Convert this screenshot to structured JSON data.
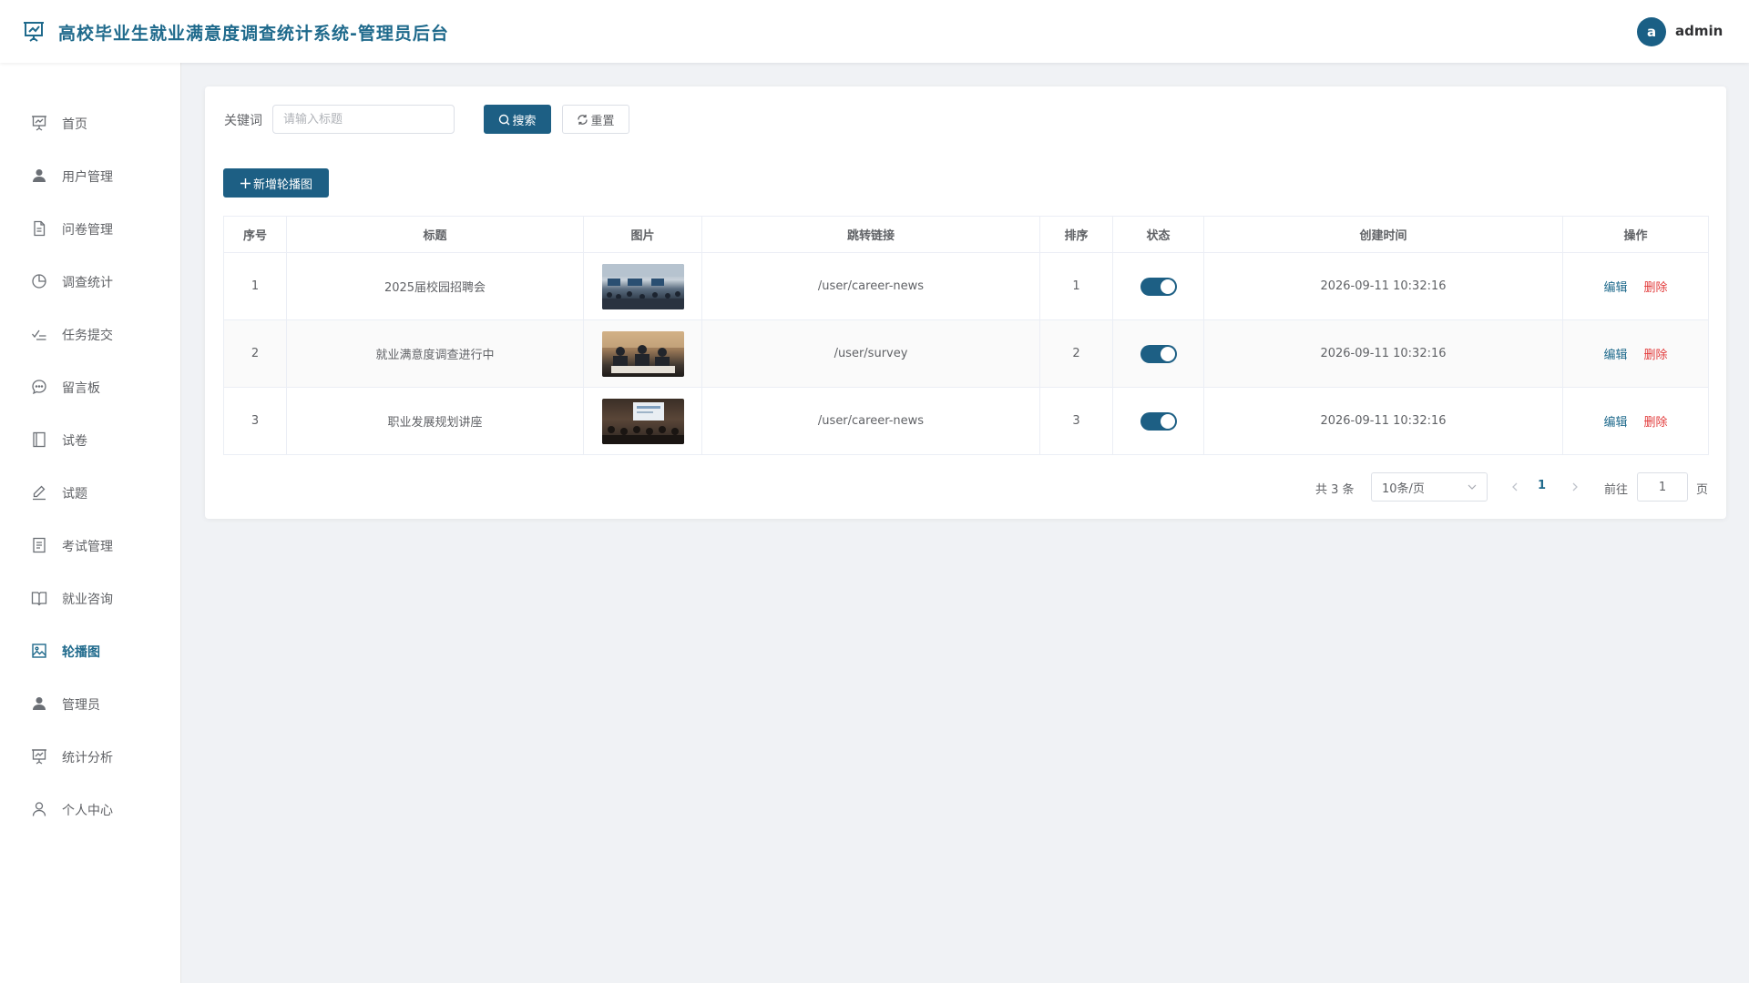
{
  "header": {
    "title": "高校毕业生就业满意度调查统计系统-管理员后台",
    "avatar_letter": "a",
    "username": "admin"
  },
  "sidebar": {
    "items": [
      {
        "label": "首页",
        "icon": "presentation-icon"
      },
      {
        "label": "用户管理",
        "icon": "user-icon"
      },
      {
        "label": "问卷管理",
        "icon": "document-icon"
      },
      {
        "label": "调查统计",
        "icon": "pie-chart-icon"
      },
      {
        "label": "任务提交",
        "icon": "task-check-icon"
      },
      {
        "label": "留言板",
        "icon": "chat-bubble-icon"
      },
      {
        "label": "试卷",
        "icon": "notebook-icon"
      },
      {
        "label": "试题",
        "icon": "edit-pen-icon"
      },
      {
        "label": "考试管理",
        "icon": "list-document-icon"
      },
      {
        "label": "就业咨询",
        "icon": "open-book-icon"
      },
      {
        "label": "轮播图",
        "icon": "image-icon"
      },
      {
        "label": "管理员",
        "icon": "user-icon"
      },
      {
        "label": "统计分析",
        "icon": "presentation-icon"
      },
      {
        "label": "个人中心",
        "icon": "user-outline-icon"
      }
    ],
    "active": "轮播图"
  },
  "search": {
    "label": "关键词",
    "placeholder": "请输入标题",
    "value": "",
    "search_button": "搜索",
    "reset_button": "重置"
  },
  "add_button": "新增轮播图",
  "table": {
    "headers": [
      "序号",
      "标题",
      "图片",
      "跳转链接",
      "排序",
      "状态",
      "创建时间",
      "操作"
    ],
    "rows": [
      {
        "index": "1",
        "title": "2025届校园招聘会",
        "link": "/user/career-news",
        "sort": "1",
        "status_on": true,
        "created": "2026-09-11 10:32:16",
        "edit": "编辑",
        "delete": "删除"
      },
      {
        "index": "2",
        "title": "就业满意度调查进行中",
        "link": "/user/survey",
        "sort": "2",
        "status_on": true,
        "created": "2026-09-11 10:32:16",
        "edit": "编辑",
        "delete": "删除"
      },
      {
        "index": "3",
        "title": "职业发展规划讲座",
        "link": "/user/career-news",
        "sort": "3",
        "status_on": true,
        "created": "2026-09-11 10:32:16",
        "edit": "编辑",
        "delete": "删除"
      }
    ]
  },
  "pagination": {
    "total": "共 3 条",
    "page_size": "10条/页",
    "current_page": "1",
    "goto_label": "前往",
    "goto_value": "1",
    "page_unit": "页"
  },
  "colors": {
    "primary": "#1d5f84",
    "title": "#1f6a8c",
    "danger": "#e23b3b",
    "background": "#f0f2f5"
  }
}
